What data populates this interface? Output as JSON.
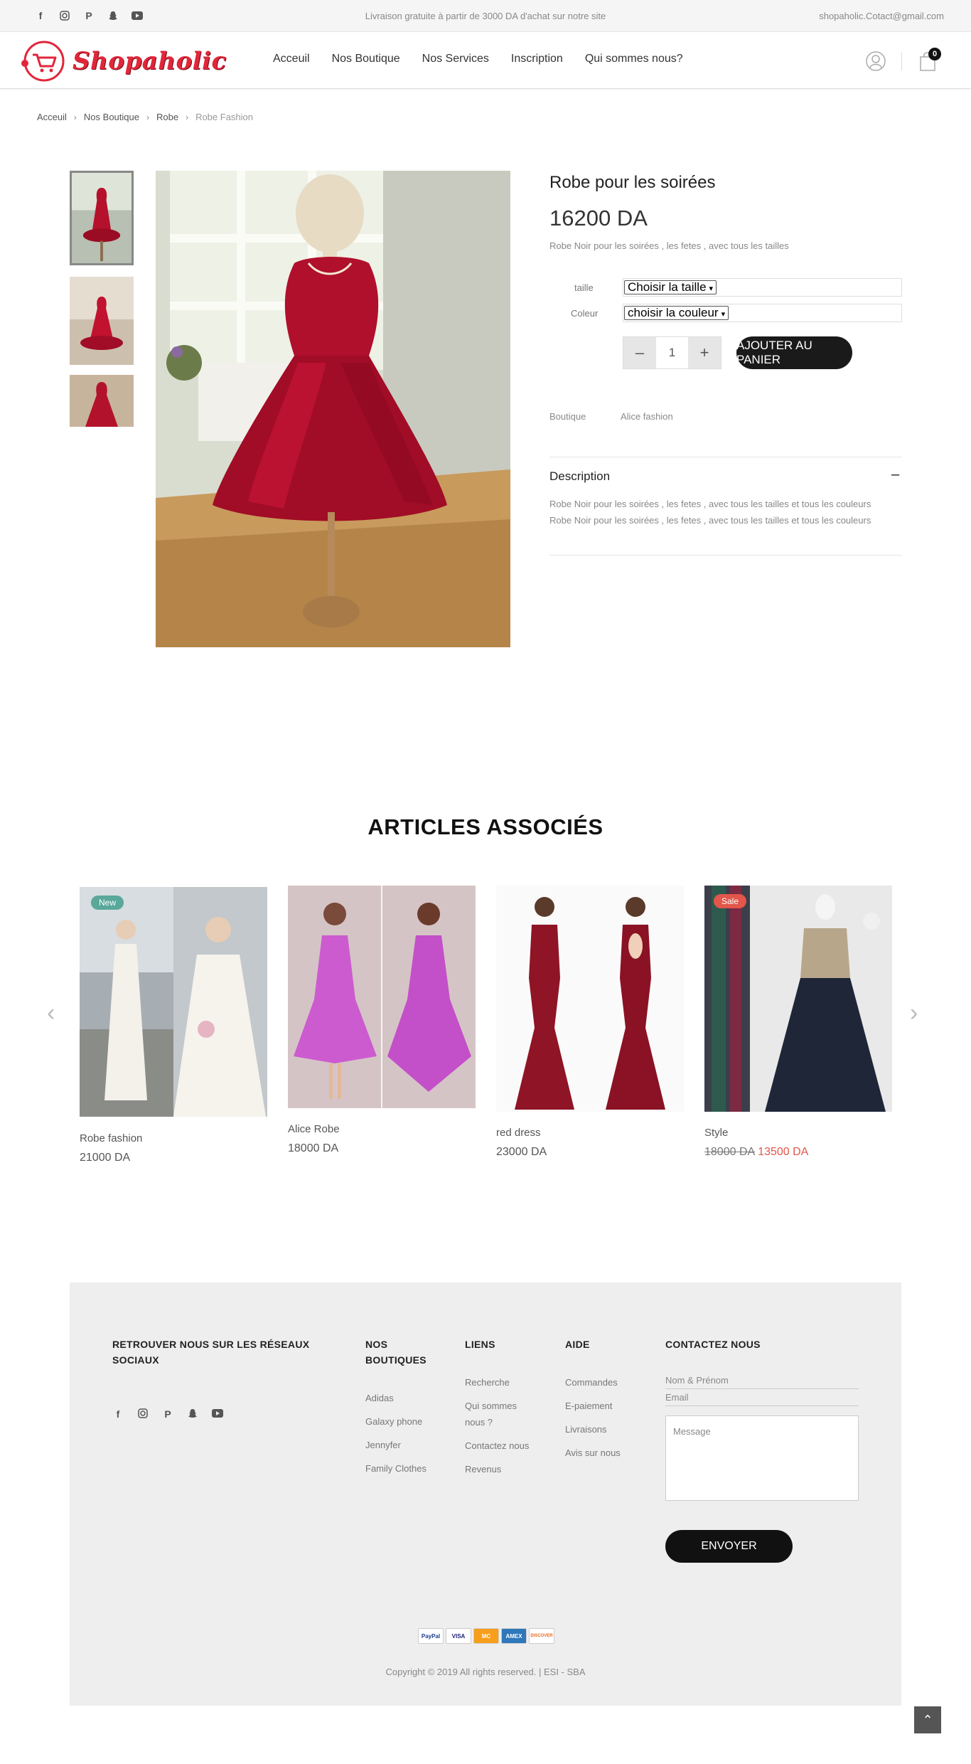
{
  "topbar": {
    "promo": "Livraison gratuite à partir de 3000 DA d'achat sur notre site",
    "email": "shopaholic.Cotact@gmail.com",
    "socials": [
      "facebook-icon",
      "instagram-icon",
      "pinterest-icon",
      "snapchat-icon",
      "youtube-icon"
    ]
  },
  "header": {
    "logo_text": "Shopaholic",
    "nav": [
      "Acceuil",
      "Nos Boutique",
      "Nos Services",
      "Inscription",
      "Qui sommes nous?"
    ],
    "cart_count": "0"
  },
  "breadcrumb": [
    "Acceuil",
    "Nos Boutique",
    "Robe",
    "Robe Fashion"
  ],
  "product": {
    "title": "Robe pour les soirées",
    "price": "16200 DA",
    "short_desc": "Robe Noir pour les soirées , les fetes , avec tous les tailles",
    "size_label": "taille",
    "size_value": "Choisir la taille",
    "color_label": "Coleur",
    "color_value": "choisir la couleur",
    "quantity": "1",
    "add_to_cart": "AJOUTER AU PANIER",
    "shop_label": "Boutique",
    "shop_value": "Alice fashion",
    "desc_title": "Description",
    "desc_toggle": "–",
    "desc_lines": [
      "Robe Noir pour les soirées , les fetes , avec tous les tailles et tous les couleurs",
      "Robe Noir pour les soirées , les fetes , avec tous les tailles et tous les couleurs"
    ]
  },
  "related": {
    "title": "ARTICLES ASSOCIÉS",
    "prev": "‹",
    "next": "›",
    "items": [
      {
        "name": "Robe fashion",
        "price": "21000 DA",
        "badge": "New"
      },
      {
        "name": "Alice Robe",
        "price": "18000 DA"
      },
      {
        "name": "red dress",
        "price": "23000 DA"
      },
      {
        "name": "Style",
        "old_price": "18000 DA",
        "price": "13500 DA",
        "badge": "Sale"
      }
    ]
  },
  "footer": {
    "social_title_1": "RETROUVER NOUS SUR LES RÉSEAUX",
    "social_title_2": "SOCIAUX",
    "shops_title_1": "NOS",
    "shops_title_2": "BOUTIQUES",
    "shops": [
      "Adidas",
      "Galaxy phone",
      "Jennyfer",
      "Family Clothes"
    ],
    "links_title": "LIENS",
    "links": [
      "Recherche",
      "Qui sommes",
      "nous ?",
      "Contactez nous",
      "Revenus"
    ],
    "help_title": "AIDE",
    "help": [
      "Commandes",
      "E-paiement",
      "Livraisons",
      "Avis sur nous"
    ],
    "contact_title": "CONTACTEZ NOUS",
    "name_placeholder": "Nom & Prénom",
    "email_placeholder": "Email",
    "message_placeholder": "Message",
    "send": "ENVOYER",
    "payments": [
      "PayPal",
      "VISA",
      "MC",
      "AMEX",
      "DISCOVER"
    ],
    "copyright": "Copyright © 2019 All rights reserved. | ESI - SBA"
  },
  "to_top": "⌃",
  "colors": {
    "brand_red": "#e2263a",
    "button_dark": "#1a1a1a",
    "sale_price": "#e2564b",
    "new_badge": "#5aa89a",
    "sale_badge": "#e2564b"
  }
}
